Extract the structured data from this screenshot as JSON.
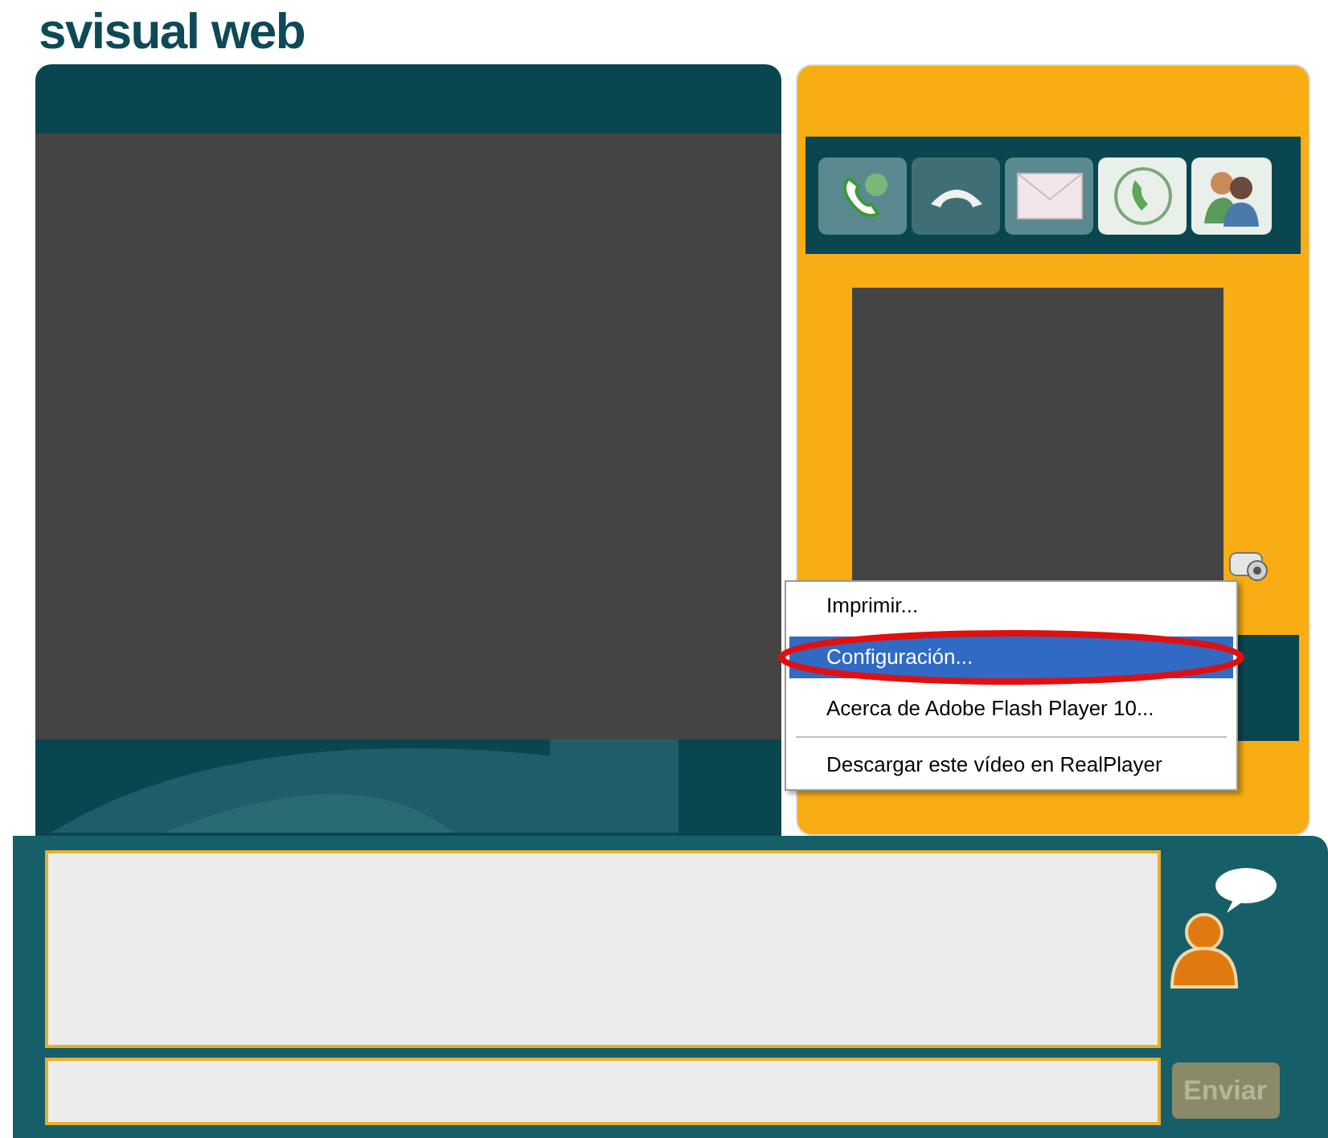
{
  "logo": "svisual web",
  "context_menu": {
    "items": [
      {
        "kind": "item",
        "label": "Imprimir...",
        "selected": false
      },
      {
        "kind": "item",
        "label": "Configuración...",
        "selected": true
      },
      {
        "kind": "item",
        "label": "Acerca de Adobe Flash Player 10...",
        "selected": false
      },
      {
        "kind": "separator"
      },
      {
        "kind": "item",
        "label": "Descargar este vídeo en RealPlayer",
        "selected": false
      }
    ]
  },
  "chat": {
    "send_button": "Enviar"
  }
}
